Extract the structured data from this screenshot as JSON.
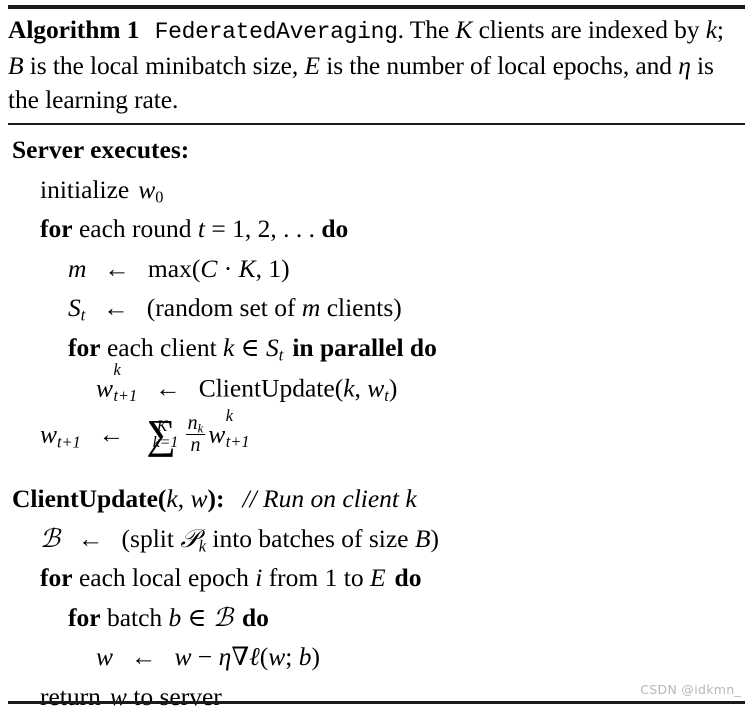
{
  "algorithm": {
    "label": "Algorithm 1",
    "name": "FederatedAveraging",
    "caption_rest": ". The K clients are indexed by k; B is the local minibatch size, E is the number of local epochs, and η is the learning rate.",
    "caption_segments": {
      "s1": ". The ",
      "K": "K",
      "s2": " clients are indexed by ",
      "k": "k",
      "s3": "; ",
      "B": "B",
      "s4": " is the local minibatch size, ",
      "E": "E",
      "s5": " is the number of local epochs, and ",
      "eta": "η",
      "s6": " is the learning rate."
    },
    "server_heading": "Server executes:",
    "lines": {
      "initialize": {
        "kw": "initialize",
        "var": "w",
        "sub": "0"
      },
      "for_round": {
        "kw1": "for",
        "mid": " each round ",
        "var": "t",
        "eq": " = 1, 2, . . . ",
        "kw2": "do"
      },
      "m_assign": {
        "lhs": "m",
        "arrow": "←",
        "fn": "max",
        "open": "(",
        "C": "C",
        "dot": " · ",
        "K": "K",
        "comma": ", 1",
        "close": ")"
      },
      "S_assign": {
        "lhs": "S",
        "sub": "t",
        "arrow": "←",
        "text1": "(random set of ",
        "m": "m",
        "text2": " clients)"
      },
      "for_client": {
        "kw1": "for",
        "mid1": " each client ",
        "k": "k",
        "in": " ∈ ",
        "S": "S",
        "sub": "t",
        "kw2": "in parallel do"
      },
      "client_call": {
        "w": "w",
        "sup": "k",
        "sub": "t+1",
        "arrow": "←",
        "fn": "ClientUpdate",
        "open": "(",
        "k": "k",
        "comma": ", ",
        "wt": "w",
        "wtsub": "t",
        "close": ")"
      },
      "aggregate": {
        "w": "w",
        "sub": "t+1",
        "arrow": "←",
        "sum_top": "K",
        "sum_bot": "k=1",
        "num": "n",
        "numsub": "k",
        "den": "n",
        "w2": "w",
        "w2sup": "k",
        "w2sub": "t+1"
      }
    },
    "client_heading": {
      "name": "ClientUpdate",
      "open": "(",
      "k": "k",
      "comma": ", ",
      "w": "w",
      "close": "):",
      "comment": "// Run on client k"
    },
    "client_lines": {
      "batches": {
        "B": "ℬ",
        "arrow": "←",
        "text1": "(split ",
        "P": "𝒫",
        "Psub": "k",
        "text2": " into batches of size ",
        "Bsize": "B",
        "close": ")"
      },
      "for_epoch": {
        "kw1": "for",
        "mid": " each local epoch ",
        "i": "i",
        "from": " from 1 to ",
        "E": "E",
        "kw2": "do"
      },
      "for_batch": {
        "kw1": "for",
        "mid": " batch ",
        "b": "b",
        "in": " ∈ ",
        "B": "ℬ",
        "kw2": "do"
      },
      "update": {
        "w1": "w",
        "arrow": "←",
        "w2": "w",
        "minus": " − ",
        "eta": "η",
        "nabla": "∇",
        "ell": "ℓ",
        "open": "(",
        "w3": "w",
        "semi": "; ",
        "b": "b",
        "close": ")"
      },
      "return": {
        "kw": "return",
        "w": "w",
        "rest": " to server"
      }
    }
  },
  "watermark": "CSDN @idkmn_"
}
